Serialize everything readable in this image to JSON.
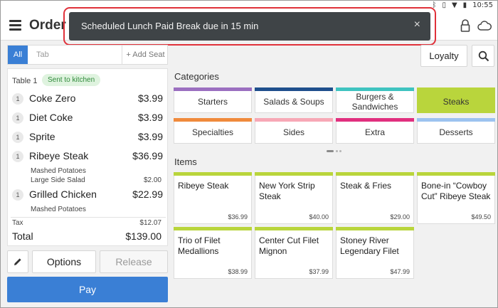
{
  "status_bar": {
    "bluetooth_icon": "bluetooth-icon",
    "vibrate_icon": "vibrate-icon",
    "wifi_icon": "wifi-icon",
    "battery_icon": "battery-icon",
    "time": "10:55"
  },
  "app_bar": {
    "title": "Order 1"
  },
  "toast": {
    "message": "Scheduled Lunch Paid Break due in 15 min",
    "close": "×"
  },
  "seat_tabs": {
    "all": "All",
    "tab_placeholder": "Tab",
    "add_seat": "+ Add Seat"
  },
  "order": {
    "table": "Table 1",
    "status_badge": "Sent to kitchen",
    "items": [
      {
        "qty": "1",
        "name": "Coke Zero",
        "price": "$3.99",
        "modifiers": []
      },
      {
        "qty": "1",
        "name": "Diet Coke",
        "price": "$3.99",
        "modifiers": []
      },
      {
        "qty": "1",
        "name": "Sprite",
        "price": "$3.99",
        "modifiers": []
      },
      {
        "qty": "1",
        "name": "Ribeye Steak",
        "price": "$36.99",
        "modifiers": [
          {
            "name": "Mashed Potatoes",
            "price": ""
          },
          {
            "name": "Large Side Salad",
            "price": "$2.00"
          }
        ]
      },
      {
        "qty": "1",
        "name": "Grilled Chicken",
        "price": "$22.99",
        "modifiers": [
          {
            "name": "Mashed Potatoes",
            "price": ""
          }
        ]
      }
    ],
    "tax_label": "Tax",
    "tax": "$12.07",
    "total_label": "Total",
    "total": "$139.00"
  },
  "actions": {
    "options": "Options",
    "release": "Release",
    "pay": "Pay"
  },
  "loyalty": "Loyalty",
  "categories_title": "Categories",
  "categories": [
    {
      "label": "Starters",
      "color": "#9b6fc0",
      "active": false
    },
    {
      "label": "Salads & Soups",
      "color": "#1f4f8c",
      "active": false
    },
    {
      "label": "Burgers & Sandwiches",
      "color": "#3fc3c0",
      "active": false
    },
    {
      "label": "Steaks",
      "color": "#b9d53c",
      "active": true
    },
    {
      "label": "Specialties",
      "color": "#f08a3c",
      "active": false
    },
    {
      "label": "Sides",
      "color": "#f7a8b6",
      "active": false
    },
    {
      "label": "Extra",
      "color": "#e02f7e",
      "active": false
    },
    {
      "label": "Desserts",
      "color": "#9cc3f0",
      "active": false
    }
  ],
  "items_title": "Items",
  "items": [
    {
      "name": "Ribeye Steak",
      "price": "$36.99"
    },
    {
      "name": "New York Strip Steak",
      "price": "$40.00"
    },
    {
      "name": "Steak & Fries",
      "price": "$29.00"
    },
    {
      "name": "Bone-in “Cowboy Cut” Ribeye Steak",
      "price": "$49.50"
    },
    {
      "name": "Trio of Filet Medallions",
      "price": "$38.99"
    },
    {
      "name": "Center Cut Filet Mignon",
      "price": "$37.99"
    },
    {
      "name": "Stoney River Legendary Filet",
      "price": "$47.99"
    }
  ],
  "colors": {
    "accent": "#3a7fd5",
    "active_category": "#b9d53c",
    "toast_bg": "#3f4447",
    "highlight": "#e0313a"
  }
}
